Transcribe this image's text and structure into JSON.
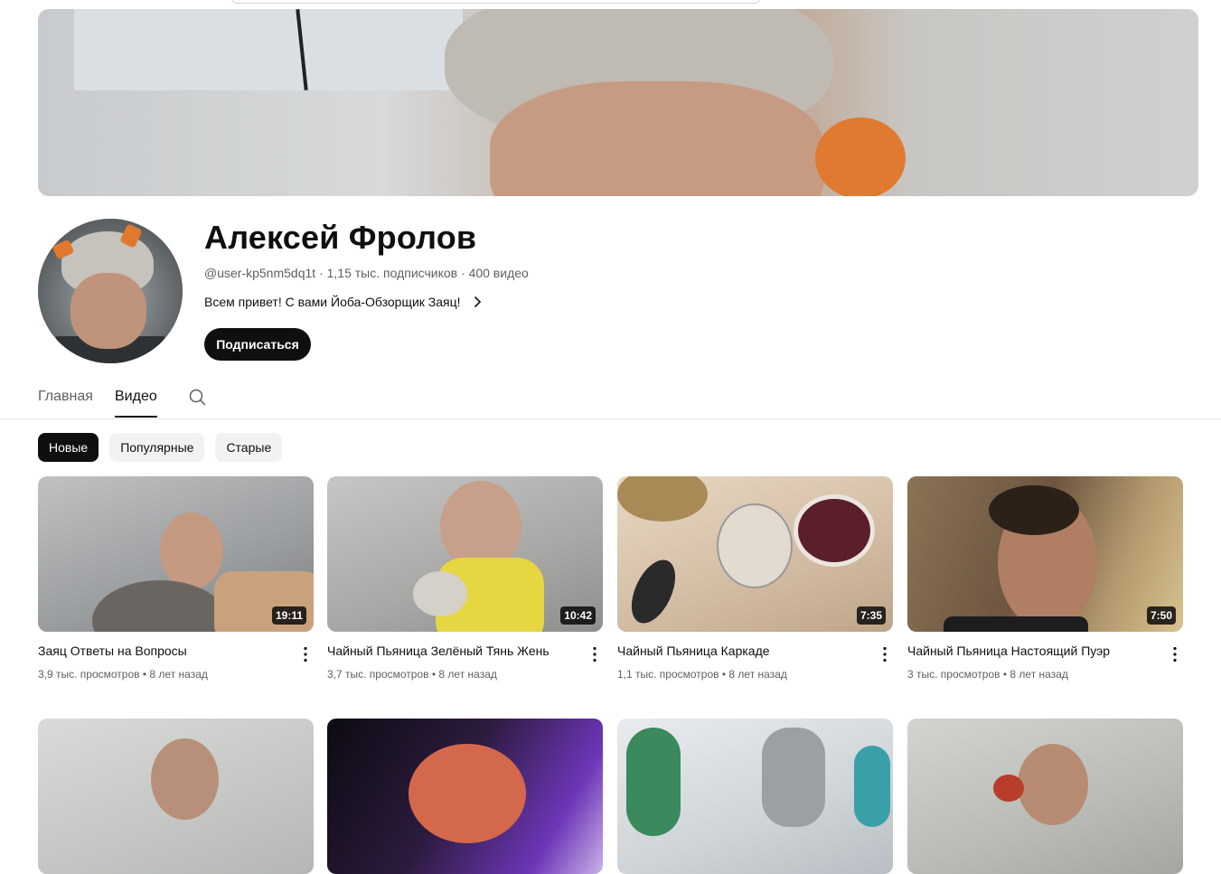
{
  "channel": {
    "name": "Алексей Фролов",
    "handle": "@user-kp5nm5dq1t",
    "subscribers": "1,15 тыс. подписчиков",
    "video_count": "400 видео",
    "description": "Всем привет! С вами Йоба-Обзорщик Заяц!",
    "subscribe_label": "Подписаться"
  },
  "tabs": {
    "home": "Главная",
    "videos": "Видео"
  },
  "chips": [
    "Новые",
    "Популярные",
    "Старые"
  ],
  "videos": [
    {
      "title": "Заяц Ответы на Вопросы",
      "duration": "19:11",
      "views": "3,9 тыс. просмотров",
      "age": "8 лет назад"
    },
    {
      "title": "Чайный Пьяница Зелёный Тянь Жень",
      "duration": "10:42",
      "views": "3,7 тыс. просмотров",
      "age": "8 лет назад"
    },
    {
      "title": "Чайный Пьяница Каркаде",
      "duration": "7:35",
      "views": "1,1 тыс. просмотров",
      "age": "8 лет назад"
    },
    {
      "title": "Чайный Пьяница Настоящий Пуэр",
      "duration": "7:50",
      "views": "3 тыс. просмотров",
      "age": "8 лет назад"
    }
  ],
  "separator": "•",
  "colors": {
    "text": "#0f0f0f",
    "secondary": "#606060",
    "chip_bg": "#f2f2f2",
    "subscribe_bg": "#0f0f0f"
  }
}
